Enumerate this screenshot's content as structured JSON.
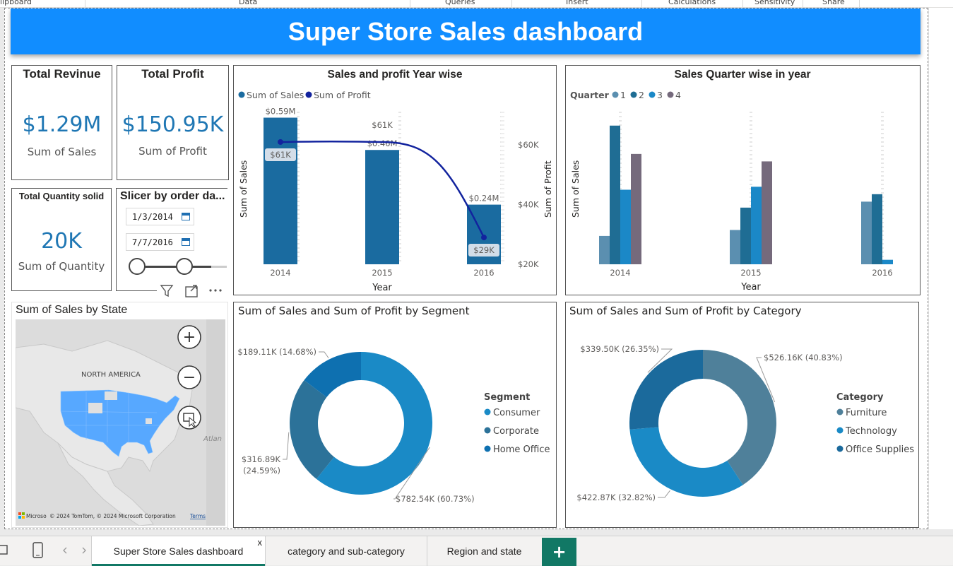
{
  "ribbon": {
    "groups": [
      "lipboard",
      "Data",
      "Queries",
      "Insert",
      "Calculations",
      "Sensitivity",
      "Share"
    ]
  },
  "dashboard_title": "Super Store Sales dashboard",
  "kpis": {
    "revenue": {
      "title": "Total Revinue",
      "value": "$1.29M",
      "label": "Sum of Sales"
    },
    "profit": {
      "title": "Total Profit",
      "value": "$150.95K",
      "label": "Sum of Profit"
    },
    "quantity": {
      "title": "Total Quantity solid",
      "value": "20K",
      "label": "Sum of Quantity"
    }
  },
  "slicer": {
    "title": "Slicer by order da...",
    "start_date": "1/3/2014",
    "end_date": "7/7/2016"
  },
  "map": {
    "title": "Sum of Sales by State",
    "region_label": "NORTH AMERICA",
    "ocean_label": "Atlan",
    "logo_text": "Microso",
    "attribution": "© 2024 TomTom, © 2024 Microsoft Corporation",
    "terms": "Terms",
    "zoom_in": "+",
    "zoom_out": "−"
  },
  "chart_data": [
    {
      "type": "bar",
      "title": "Sales and profit Year wise",
      "categories": [
        "2014",
        "2015",
        "2016"
      ],
      "series": [
        {
          "name": "Sum of Sales",
          "values": [
            0.59,
            0.46,
            0.24
          ],
          "labels": [
            "$0.59M",
            "$0.46M",
            "$0.24M"
          ],
          "color": "#1a6ba0"
        },
        {
          "name": "Sum of Profit",
          "type": "line",
          "values": [
            61,
            61,
            29
          ],
          "labels": [
            "$61K",
            "$61K",
            "$29K"
          ],
          "color": "#12239e"
        }
      ],
      "xlabel": "Year",
      "ylabel": "Sum of Sales",
      "y2label": "Sum of Profit",
      "ylim": [
        0,
        0.6
      ],
      "y2lim": [
        20,
        70
      ],
      "y2ticks": [
        "$20K",
        "$40K",
        "$60K"
      ]
    },
    {
      "type": "bar",
      "title": "Sales Quarter wise in year",
      "legend_title": "Quarter",
      "categories": [
        "2014",
        "2015",
        "2016"
      ],
      "series": [
        {
          "name": "1",
          "values": [
            0.19,
            0.23,
            0.42
          ],
          "color": "#5b8fb0"
        },
        {
          "name": "2",
          "values": [
            0.93,
            0.38,
            0.47
          ],
          "color": "#1f6d94"
        },
        {
          "name": "3",
          "values": [
            0.5,
            0.52,
            0.03
          ],
          "color": "#1b88c7"
        },
        {
          "name": "4",
          "values": [
            0.74,
            0.69,
            0.0
          ],
          "color": "#756a7c"
        }
      ],
      "xlabel": "Year",
      "ylabel": "Sum of Sales",
      "ylim": [
        0,
        1
      ]
    },
    {
      "type": "pie",
      "title": "Sum of Sales and Sum of Profit by Segment",
      "legend_title": "Segment",
      "slices": [
        {
          "name": "Consumer",
          "value": 60.73,
          "label": "$782.54K (60.73%)",
          "color": "#1a8ac6"
        },
        {
          "name": "Corporate",
          "value": 24.59,
          "label": "$316.89K (24.59%)",
          "color": "#2c7299"
        },
        {
          "name": "Home Office",
          "value": 14.68,
          "label": "$189.11K (14.68%)",
          "color": "#0e70b0"
        }
      ]
    },
    {
      "type": "pie",
      "title": "Sum of Sales and Sum of Profit by Category",
      "legend_title": "Category",
      "slices": [
        {
          "name": "Furniture",
          "value": 40.83,
          "label": "$526.16K (40.83%)",
          "color": "#4f809a"
        },
        {
          "name": "Technology",
          "value": 32.82,
          "label": "$422.87K (32.82%)",
          "color": "#1a8ac6"
        },
        {
          "name": "Office Supplies",
          "value": 26.35,
          "label": "$339.50K (26.35%)",
          "color": "#1b6a9c"
        }
      ]
    }
  ],
  "tabs": {
    "items": [
      "Super Store Sales dashboard",
      "category and sub-category",
      "Region and state"
    ],
    "close": "x",
    "add": "+"
  }
}
